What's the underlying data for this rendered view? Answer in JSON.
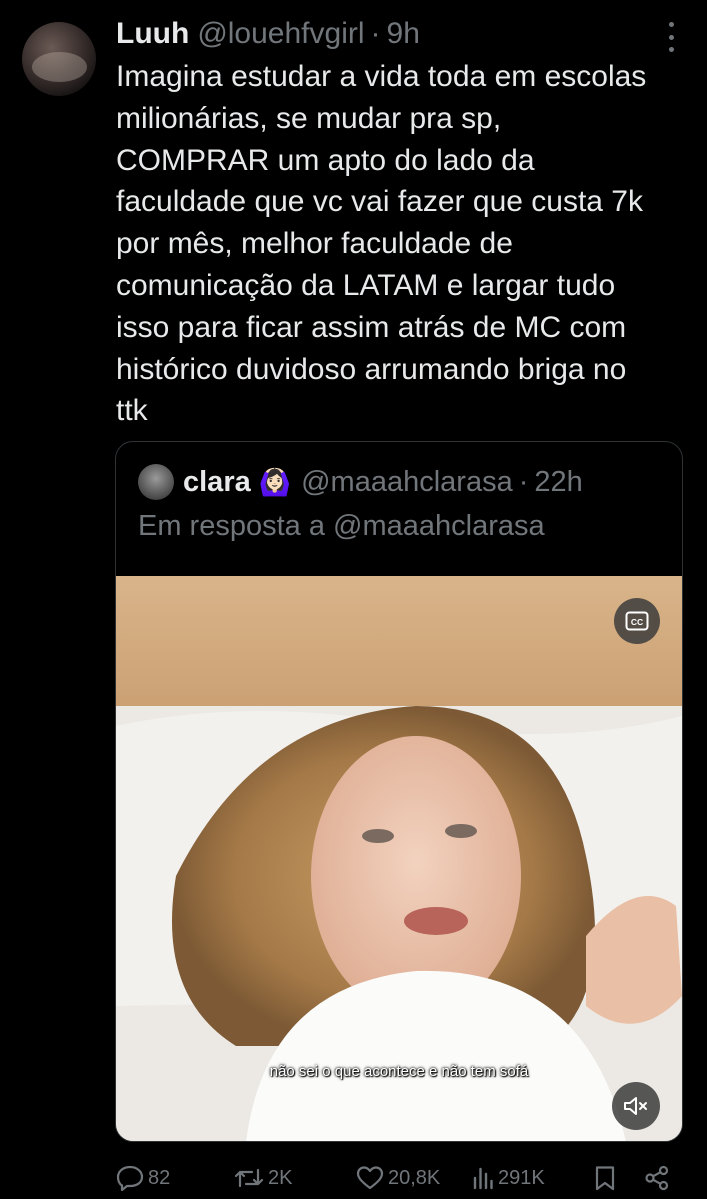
{
  "tweet": {
    "author_name": "Luuh",
    "author_handle": "@louehfvgirl",
    "separator": "·",
    "time": "9h",
    "text": "Imagina estudar a vida toda em escolas\nmilionárias, se mudar pra sp,\nCOMPRAR um apto do lado da\nfaculdade que vc vai fazer que custa 7k\npor mês, melhor faculdade de\ncomunicação da LATAM e largar tudo\nisso para ficar assim atrás de MC com\nhistórico duvidoso arrumando briga no\nttk"
  },
  "quoted": {
    "author_name": "clara",
    "author_emoji": "🙆🏻‍♀️",
    "author_handle": "@maaahclarasa",
    "separator": "·",
    "time": "22h",
    "reply_to": "Em resposta a @maaahclarasa",
    "video": {
      "subtitle": "não sei o que acontece e não tem sofá",
      "cc_icon": "closed-captions-icon",
      "mute_icon": "muted-speaker-icon"
    }
  },
  "actions": {
    "replies": "82",
    "reposts": "2K",
    "likes": "20,8K",
    "views": "291K"
  },
  "colors": {
    "background": "#000000",
    "text": "#e7e9ea",
    "secondary": "#71767b",
    "border": "#2f3336"
  }
}
